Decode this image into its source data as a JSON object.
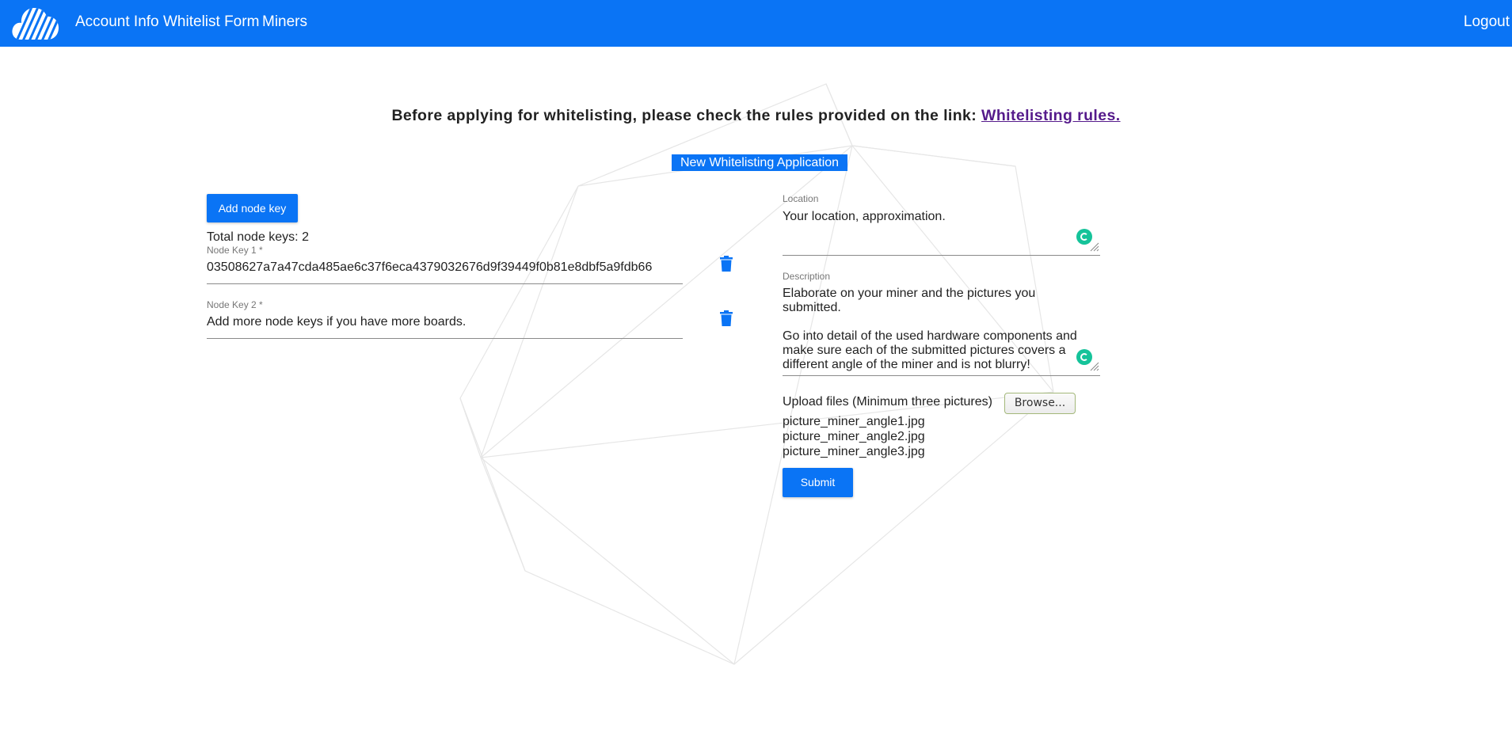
{
  "nav": {
    "links": [
      "Account Info",
      "Whitelist Form",
      "Miners"
    ],
    "logout": "Logout"
  },
  "notice": {
    "text": "Before applying for whitelisting, please check the rules provided on the link: ",
    "link_text": "Whitelisting rules."
  },
  "form": {
    "title": "New Whitelisting Application",
    "add_node_key_label": "Add node key",
    "total_keys": "Total node keys: 2",
    "node_keys": [
      {
        "label": "Node Key 1 *",
        "value": "03508627a7a47cda485ae6c37f6eca4379032676d9f39449f0b81e8dbf5a9fdb66"
      },
      {
        "label": "Node Key 2 *",
        "placeholder": "Add more node keys if you have more boards."
      }
    ],
    "location": {
      "label": "Location",
      "placeholder": "Your location, approximation."
    },
    "description": {
      "label": "Description",
      "line1": "Elaborate on your miner and the pictures you submitted.",
      "line2": "Go into detail of the used hardware components and",
      "line3": "make sure each of the submitted pictures covers a",
      "line4": "different angle of the miner and is not blurry!"
    },
    "upload": {
      "label": "Upload files (Minimum three pictures)",
      "browse_label": "Browse...",
      "files": [
        "picture_miner_angle1.jpg",
        "picture_miner_angle2.jpg",
        "picture_miner_angle3.jpg"
      ]
    },
    "submit_label": "Submit"
  },
  "colors": {
    "primary": "#0a74f5",
    "link_visited": "#551a8b",
    "grammarly": "#15c39a"
  }
}
